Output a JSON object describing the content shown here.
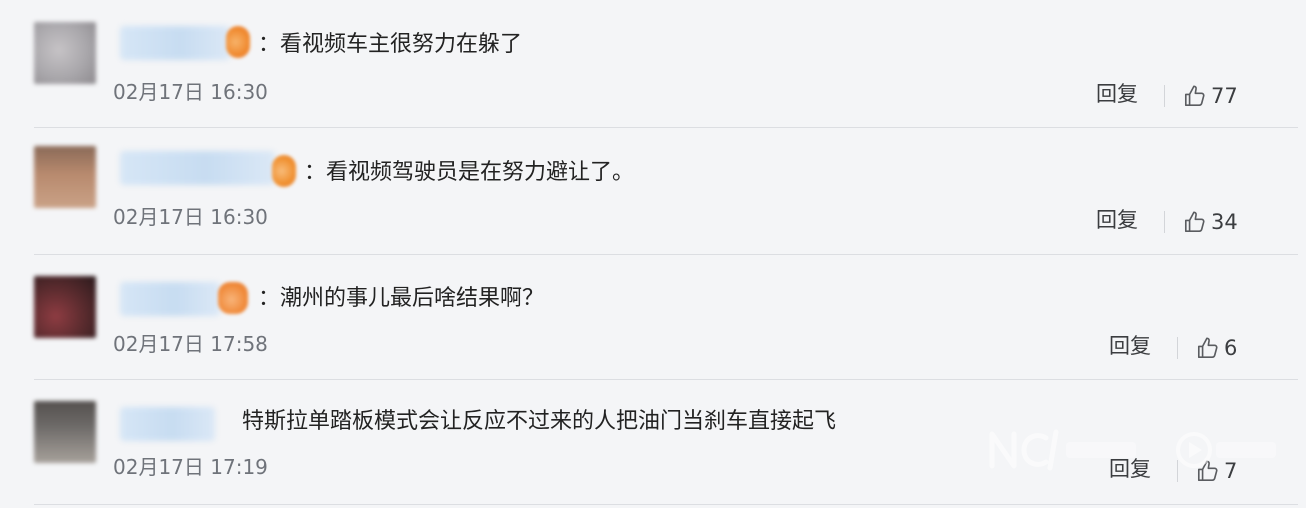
{
  "comments": [
    {
      "text": "：看视频车主很努力在躲了",
      "time": "02月17日 16:30",
      "reply_label": "回复",
      "likes": "77",
      "colors": {
        "avatar": "#a9a7ab",
        "badge": "#f08a30"
      }
    },
    {
      "text": "：看视频驾驶员是在努力避让了。",
      "time": "02月17日 16:30",
      "reply_label": "回复",
      "likes": "34",
      "colors": {
        "avatar": "#b88a6e",
        "badge": "#f09030"
      }
    },
    {
      "text": "：潮州的事儿最后啥结果啊？",
      "time": "02月17日 17:58",
      "reply_label": "回复",
      "likes": "6",
      "colors": {
        "avatar": "#5a2b2e",
        "badge": "#f08a3a"
      }
    },
    {
      "text": "特斯拉单踏板模式会让反应不过来的人把油门当刹车直接起飞",
      "time": "02月17日 17:19",
      "reply_label": "回复",
      "likes": "7",
      "colors": {
        "avatar": "#6d6a68",
        "badge": ""
      }
    }
  ],
  "icons": {
    "like": "thumbs-up-icon",
    "watermark": "nc-logo"
  }
}
